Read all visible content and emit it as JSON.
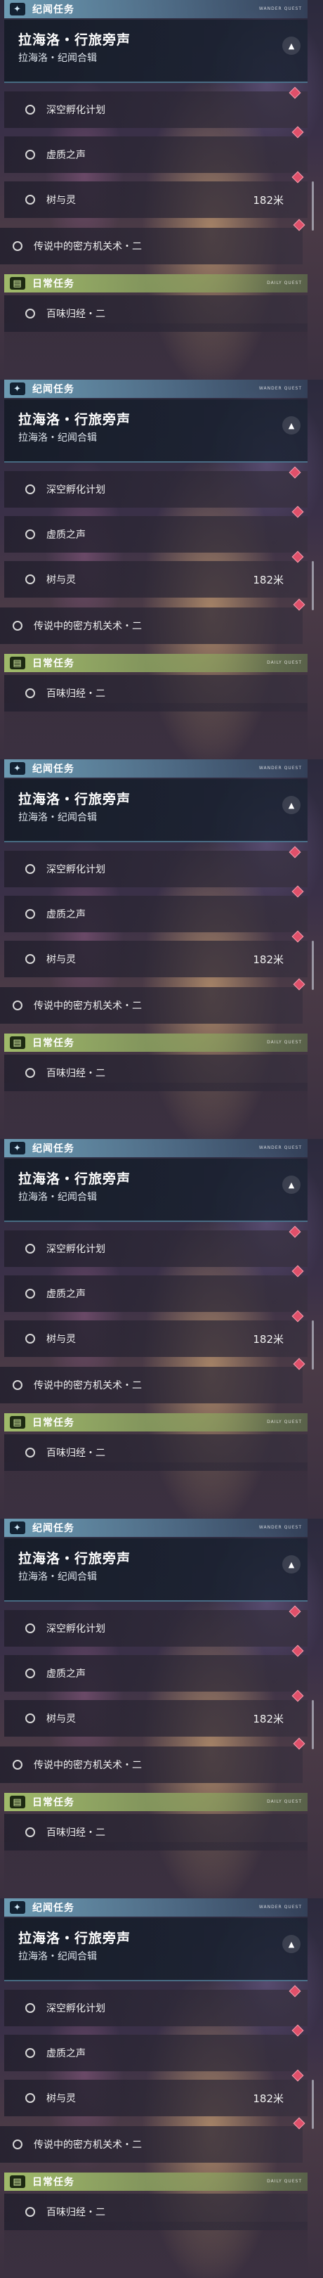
{
  "frames": 6,
  "story_section": {
    "title": "纪闻任务",
    "icon": "sparkle-icon",
    "tag": "WANDER QUEST"
  },
  "chapter": {
    "title": "拉海洛・行旅旁声",
    "subtitle": "拉海洛・纪闻合辑",
    "toggle_icon": "chevron-up-icon"
  },
  "quests": [
    {
      "label": "深空孵化计划",
      "distance": ""
    },
    {
      "label": "虚质之声",
      "distance": ""
    },
    {
      "label": "树与灵",
      "distance": "182米"
    },
    {
      "label": "传说中的密方机关术・二",
      "distance": ""
    }
  ],
  "daily_section": {
    "title": "日常任务",
    "icon": "book-icon",
    "tag": "DAILY QUEST"
  },
  "daily_quests": [
    {
      "label": "百味归经・二"
    }
  ],
  "colors": {
    "story_bar": "#78afc8",
    "daily_bar": "#aac86e",
    "pin": "#e0506a"
  }
}
